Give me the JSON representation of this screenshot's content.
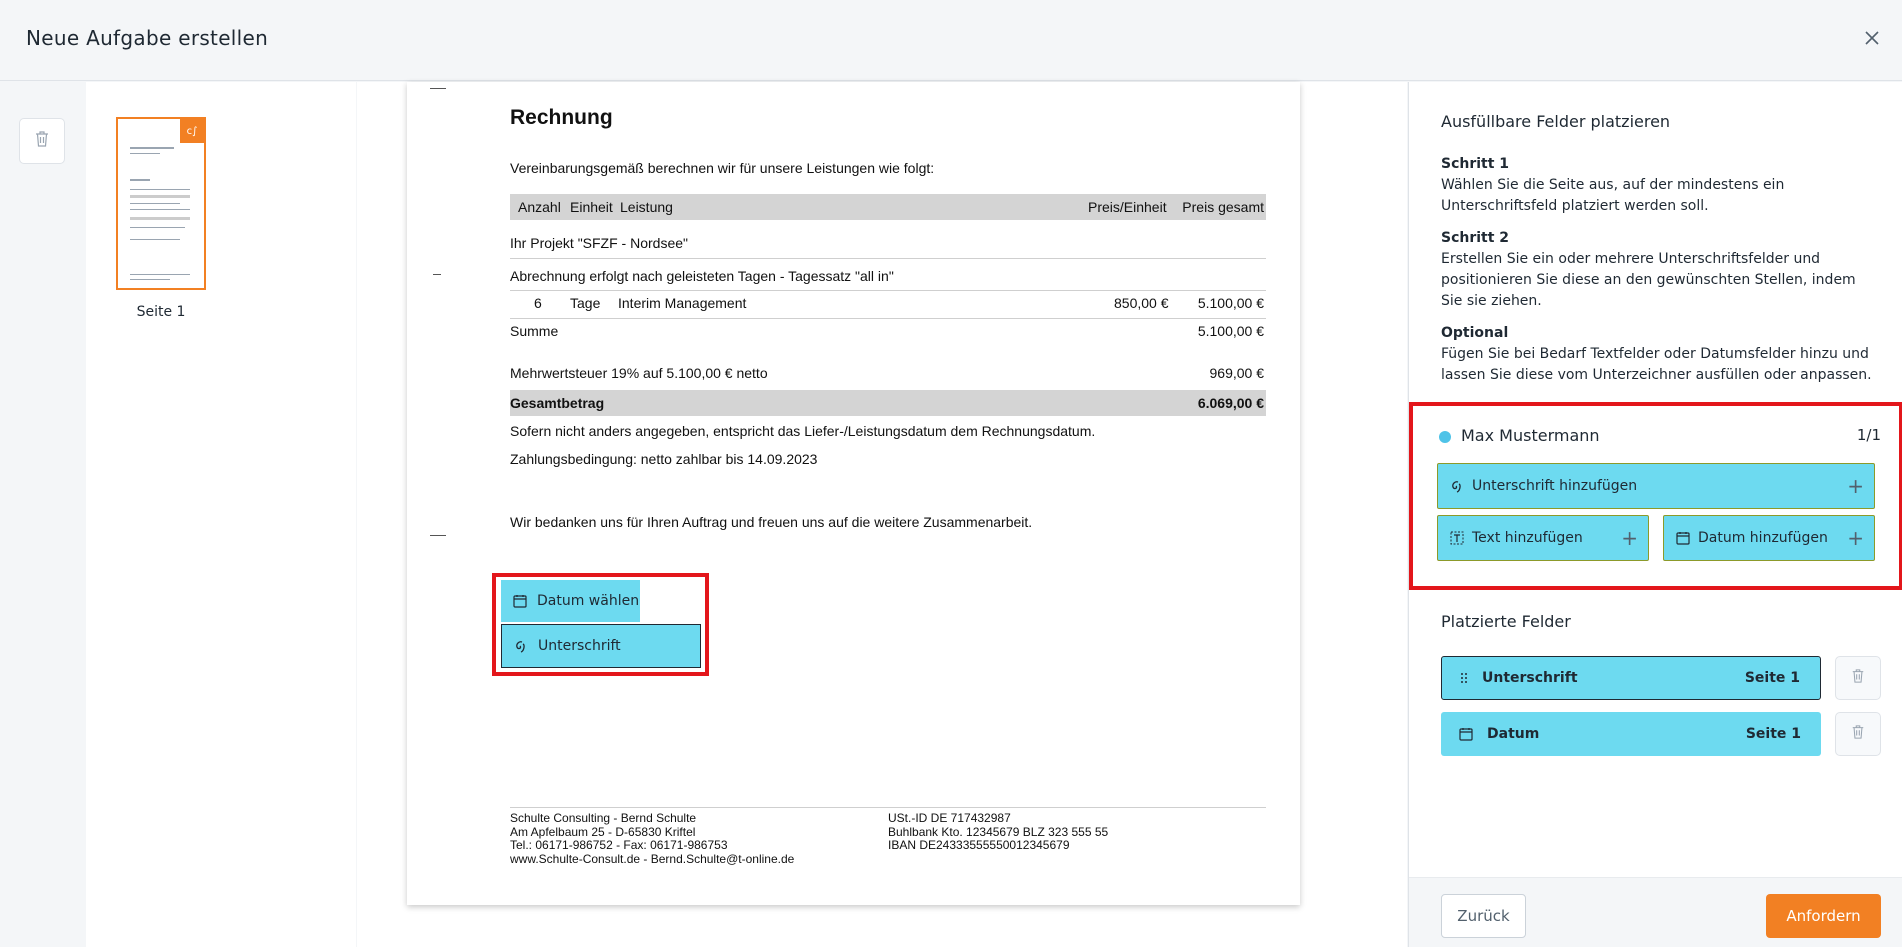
{
  "header": {
    "title": "Neue Aufgabe erstellen"
  },
  "thumbnails": {
    "page_label": "Seite 1"
  },
  "document": {
    "heading": "Rechnung",
    "intro": "Vereinbarungsgemäß berechnen wir für unsere Leistungen wie folgt:",
    "table_head": {
      "anzahl": "Anzahl",
      "einheit": "Einheit",
      "leistung": "Leistung",
      "preis_einheit": "Preis/Einheit",
      "preis_gesamt": "Preis gesamt"
    },
    "project": "Ihr Projekt \"SFZF - Nordsee\"",
    "billing_note": "Abrechnung erfolgt nach geleisteten Tagen - Tagessatz \"all in\"",
    "item": {
      "qty": "6",
      "unit": "Tage",
      "desc": "Interim Management",
      "unit_price": "850,00 €",
      "total": "5.100,00 €"
    },
    "sum_label": "Summe",
    "sum_value": "5.100,00 €",
    "vat_label": "Mehrwertsteuer 19% auf 5.100,00 € netto",
    "vat_value": "969,00 €",
    "grand_label": "Gesamtbetrag",
    "grand_value": "6.069,00 €",
    "delivery_note": "Sofern nicht anders angegeben, entspricht das Liefer-/Leistungsdatum dem Rechnungsdatum.",
    "payment_terms": "Zahlungsbedingung: netto zahlbar bis 14.09.2023",
    "thanks": "Wir bedanken uns für Ihren Auftrag und freuen uns auf die weitere Zusammenarbeit.",
    "footer_left": [
      "Schulte Consulting - Bernd Schulte",
      "Am Apfelbaum 25 - D-65830 Kriftel",
      "Tel.: 06171-986752 - Fax: 06171-986753",
      "www.Schulte-Consult.de - Bernd.Schulte@t-online.de"
    ],
    "footer_right": [
      "USt.-ID DE 717432987",
      "Buhlbank Kto. 12345679 BLZ 323 555 55",
      "IBAN DE24333555550012345679"
    ],
    "placed_date_field": "Datum wählen",
    "placed_signature_field": "Unterschrift"
  },
  "panel": {
    "title": "Ausfüllbare Felder platzieren",
    "step1_title": "Schritt 1",
    "step1_text": "Wählen Sie die Seite aus, auf der mindestens ein Unterschriftsfeld platziert werden soll.",
    "step2_title": "Schritt 2",
    "step2_text": "Erstellen Sie ein oder mehrere Unterschriftsfelder und positionieren Sie diese an den gewünschten Stellen, indem Sie sie ziehen.",
    "optional_title": "Optional",
    "optional_text": "Fügen Sie bei Bedarf Textfelder oder Datumsfelder hinzu und lassen Sie diese vom Unterzeichner ausfüllen oder anpassen.",
    "signer": {
      "name": "Max Mustermann",
      "count": "1/1",
      "dot_color": "#4fc3e8"
    },
    "add_signature": "Unterschrift hinzufügen",
    "add_text": "Text hinzufügen",
    "add_date": "Datum hinzufügen",
    "placed_title": "Platzierte Felder",
    "placed": [
      {
        "name": "Unterschrift",
        "page": "Seite 1"
      },
      {
        "name": "Datum",
        "page": "Seite 1"
      }
    ],
    "back": "Zurück",
    "request": "Anfordern"
  },
  "colors": {
    "accent": "#f28023",
    "field": "#6ddaf0",
    "highlight": "#e3161b"
  }
}
